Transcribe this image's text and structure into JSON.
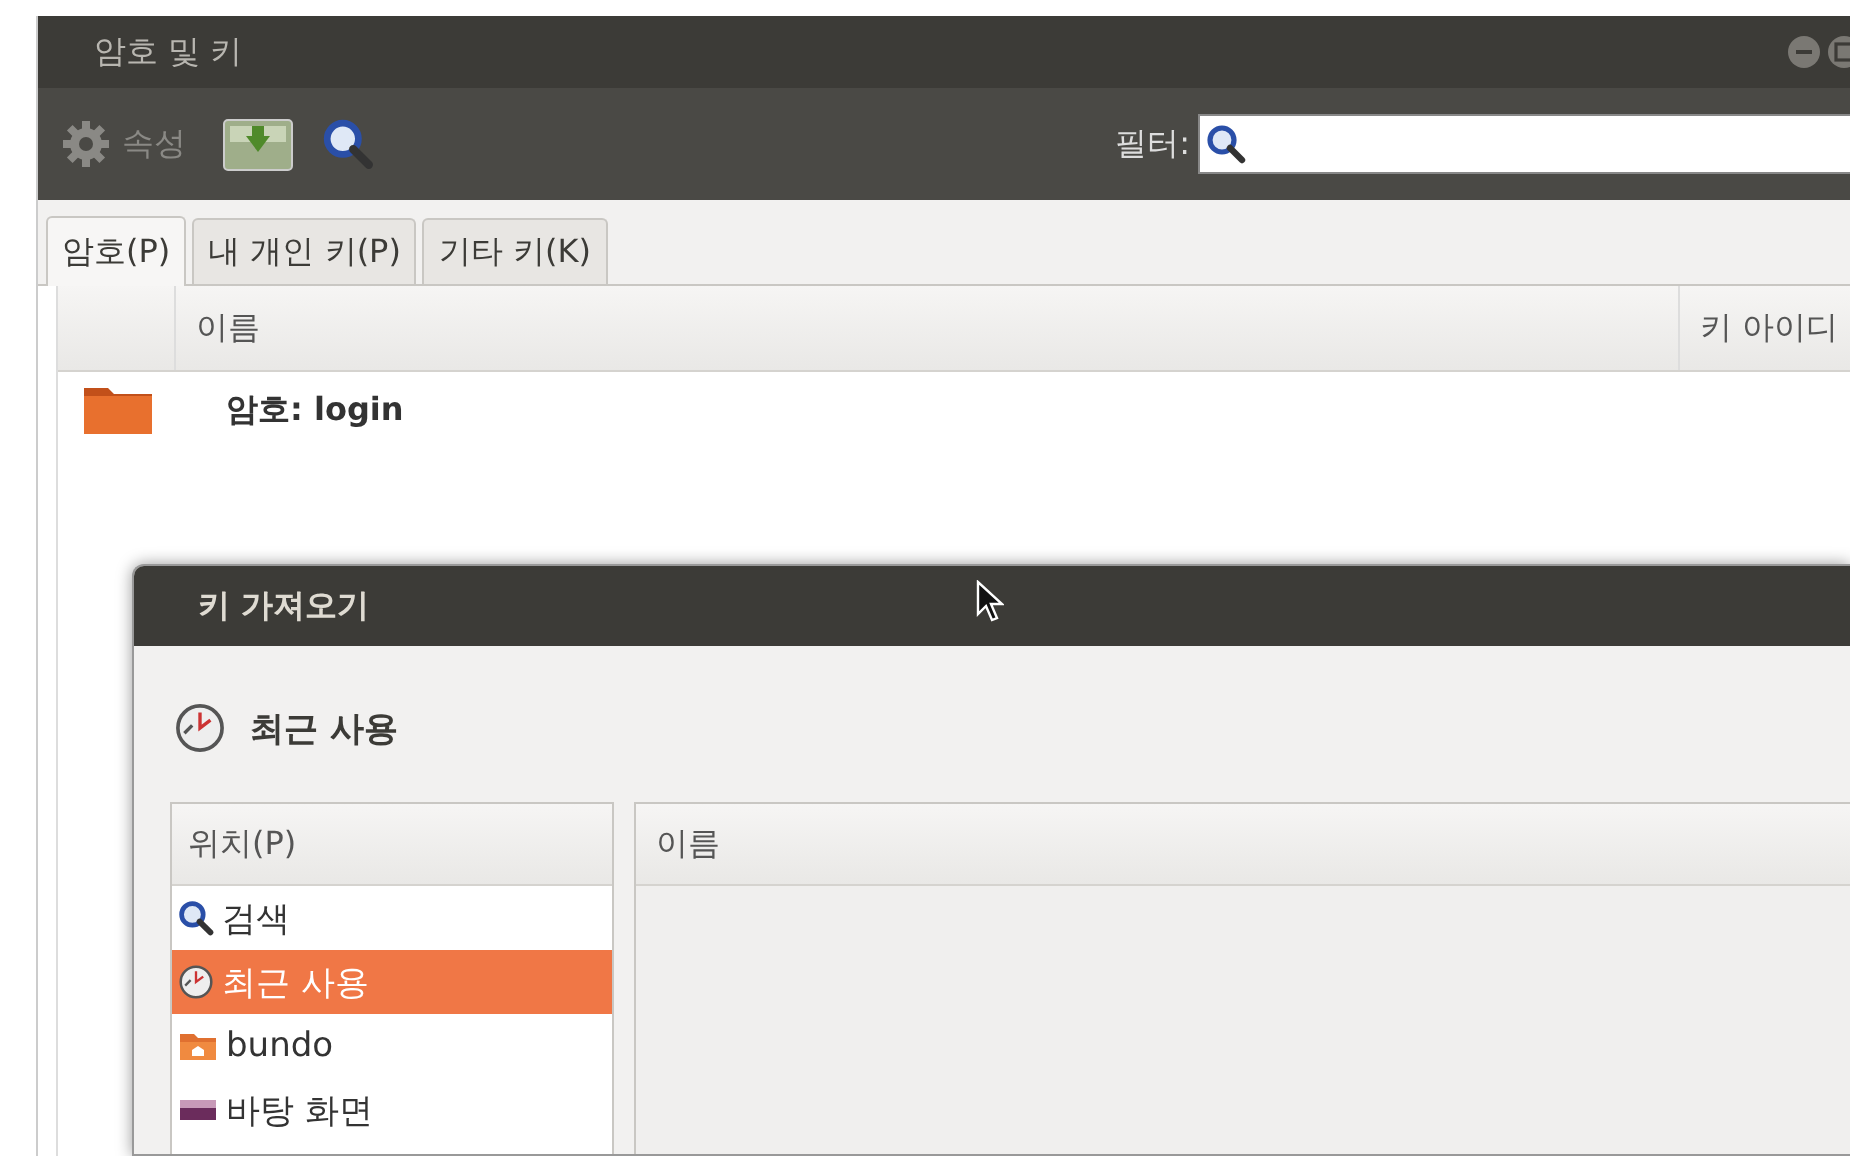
{
  "window": {
    "title": "암호 및 키"
  },
  "toolbar": {
    "items": [
      {
        "kind": "properties",
        "label": "속성",
        "disabled": true
      },
      {
        "kind": "import"
      },
      {
        "kind": "search"
      }
    ],
    "filter": {
      "label": "필터:"
    }
  },
  "tabs": [
    {
      "label": "암호(P)",
      "selected": true
    },
    {
      "label": "내 개인 키(P)",
      "selected": false
    },
    {
      "label": "기타 키(K)",
      "selected": false
    }
  ],
  "table": {
    "columns": [
      "이름",
      "키 아이디"
    ],
    "rows": [
      {
        "name": "암호: login"
      }
    ]
  },
  "dialog": {
    "title": "키 가져오기",
    "location": {
      "label": "최근 사용"
    },
    "places": {
      "header": "위치(P)",
      "items": [
        {
          "kind": "search",
          "label": "검색",
          "selected": false
        },
        {
          "kind": "recent",
          "label": "최근 사용",
          "selected": true
        },
        {
          "kind": "home",
          "label": "bundo",
          "selected": false
        },
        {
          "kind": "desktop",
          "label": "바탕 화면",
          "selected": false
        }
      ]
    },
    "files": {
      "columns": [
        "이름"
      ]
    }
  }
}
